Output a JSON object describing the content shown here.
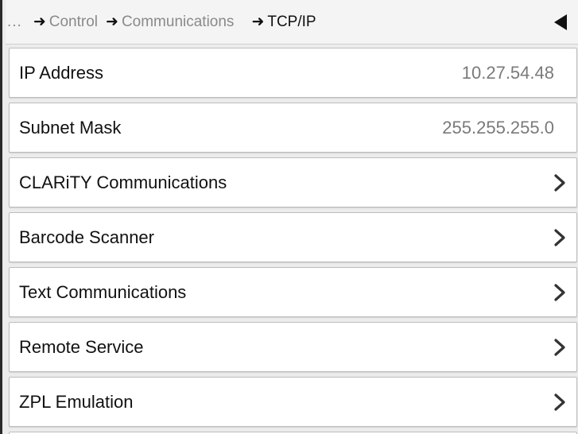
{
  "breadcrumb": {
    "ellipsis": "...",
    "items": [
      {
        "label": "Control"
      },
      {
        "label": "Communications"
      },
      {
        "label": "TCP/IP"
      }
    ]
  },
  "menu": {
    "ip_address": {
      "label": "IP Address",
      "value": "10.27.54.48"
    },
    "subnet_mask": {
      "label": "Subnet Mask",
      "value": "255.255.255.0"
    },
    "clarity": {
      "label": "CLARiTY Communications"
    },
    "barcode": {
      "label": "Barcode Scanner"
    },
    "text_comm": {
      "label": "Text Communications"
    },
    "remote_service": {
      "label": "Remote Service"
    },
    "zpl": {
      "label": "ZPL Emulation"
    }
  },
  "icons": {
    "back": "back-arrow-icon",
    "chevron": "chevron-right-icon",
    "crumb_arrow": "arrow-right-icon"
  }
}
